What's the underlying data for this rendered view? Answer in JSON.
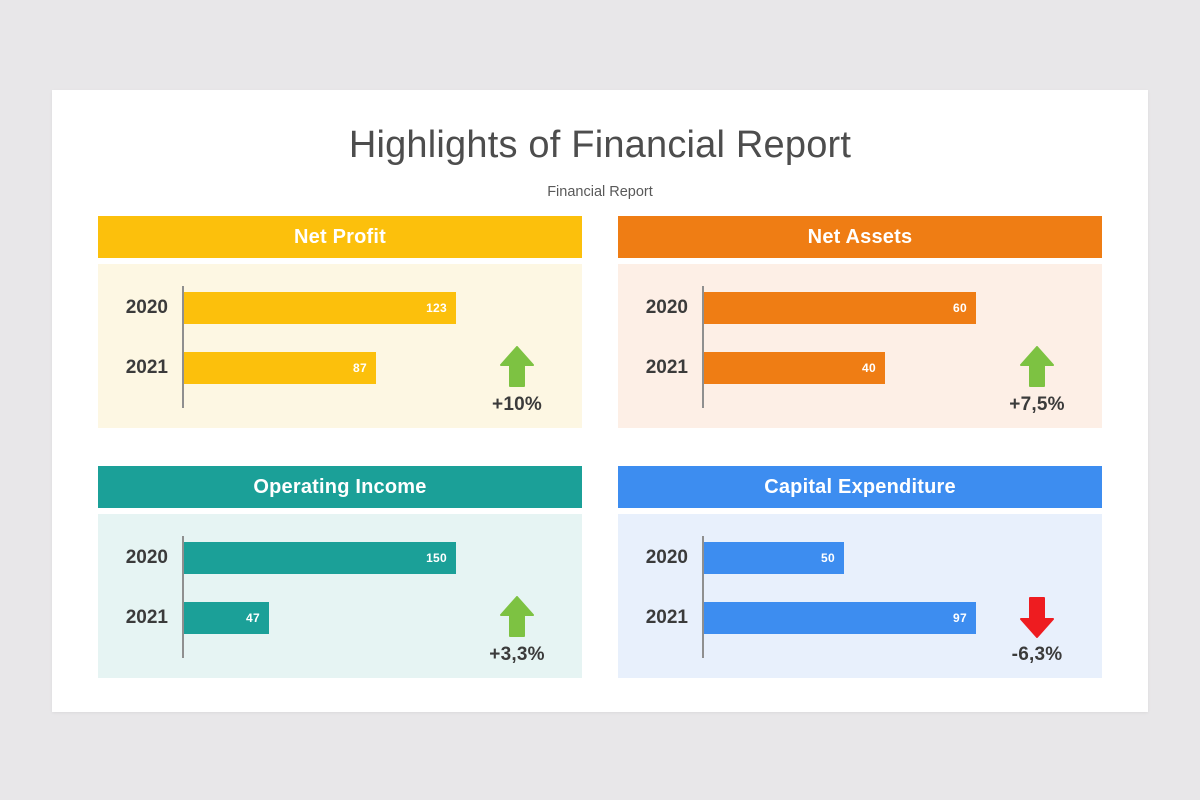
{
  "page": {
    "background": "#e8e7e9",
    "slide_background": "#ffffff"
  },
  "header": {
    "title": "Highlights of Financial Report",
    "subtitle": "Financial Report"
  },
  "colors": {
    "net_profit": "#fcc00c",
    "net_profit_tint": "#fdf7e3",
    "net_assets": "#ef7d14",
    "net_assets_tint": "#fdefe6",
    "operating_income": "#1ba098",
    "operating_income_tint": "#e6f4f3",
    "capital_expenditure": "#3d8df0",
    "capital_expenditure_tint": "#e8f0fc",
    "up_arrow": "#7dc242",
    "down_arrow": "#ee1c20",
    "axis": "#8f8f8f",
    "label_text": "#3b3b3b",
    "title_text": "#4d4d4d"
  },
  "chart_data": [
    {
      "type": "bar",
      "title": "Net Profit",
      "orientation": "horizontal",
      "categories": [
        "2020",
        "2021"
      ],
      "values": [
        123,
        87
      ],
      "xlabel": "",
      "ylabel": "",
      "xlim": [
        0,
        123
      ],
      "grid": false,
      "legend": "none",
      "series_color": "#fcc00c",
      "panel_color": "#fdf7e3",
      "annotation": {
        "change_label": "+10%",
        "direction": "up",
        "arrow_icon": "arrow-up-icon",
        "arrow_color": "#7dc242"
      }
    },
    {
      "type": "bar",
      "title": "Net Assets",
      "orientation": "horizontal",
      "categories": [
        "2020",
        "2021"
      ],
      "values": [
        60,
        40
      ],
      "xlabel": "",
      "ylabel": "",
      "xlim": [
        0,
        60
      ],
      "grid": false,
      "legend": "none",
      "series_color": "#ef7d14",
      "panel_color": "#fdefe6",
      "annotation": {
        "change_label": "+7,5%",
        "direction": "up",
        "arrow_icon": "arrow-up-icon",
        "arrow_color": "#7dc242"
      }
    },
    {
      "type": "bar",
      "title": "Operating Income",
      "orientation": "horizontal",
      "categories": [
        "2020",
        "2021"
      ],
      "values": [
        150,
        47
      ],
      "xlabel": "",
      "ylabel": "",
      "xlim": [
        0,
        150
      ],
      "grid": false,
      "legend": "none",
      "series_color": "#1ba098",
      "panel_color": "#e6f4f3",
      "annotation": {
        "change_label": "+3,3%",
        "direction": "up",
        "arrow_icon": "arrow-up-icon",
        "arrow_color": "#7dc242"
      }
    },
    {
      "type": "bar",
      "title": "Capital Expenditure",
      "orientation": "horizontal",
      "categories": [
        "2020",
        "2021"
      ],
      "values": [
        50,
        97
      ],
      "xlabel": "",
      "ylabel": "",
      "xlim": [
        0,
        97
      ],
      "grid": false,
      "legend": "none",
      "series_color": "#3d8df0",
      "panel_color": "#e8f0fc",
      "annotation": {
        "change_label": "-6,3%",
        "direction": "down",
        "arrow_icon": "arrow-down-icon",
        "arrow_color": "#ee1c20"
      }
    }
  ]
}
